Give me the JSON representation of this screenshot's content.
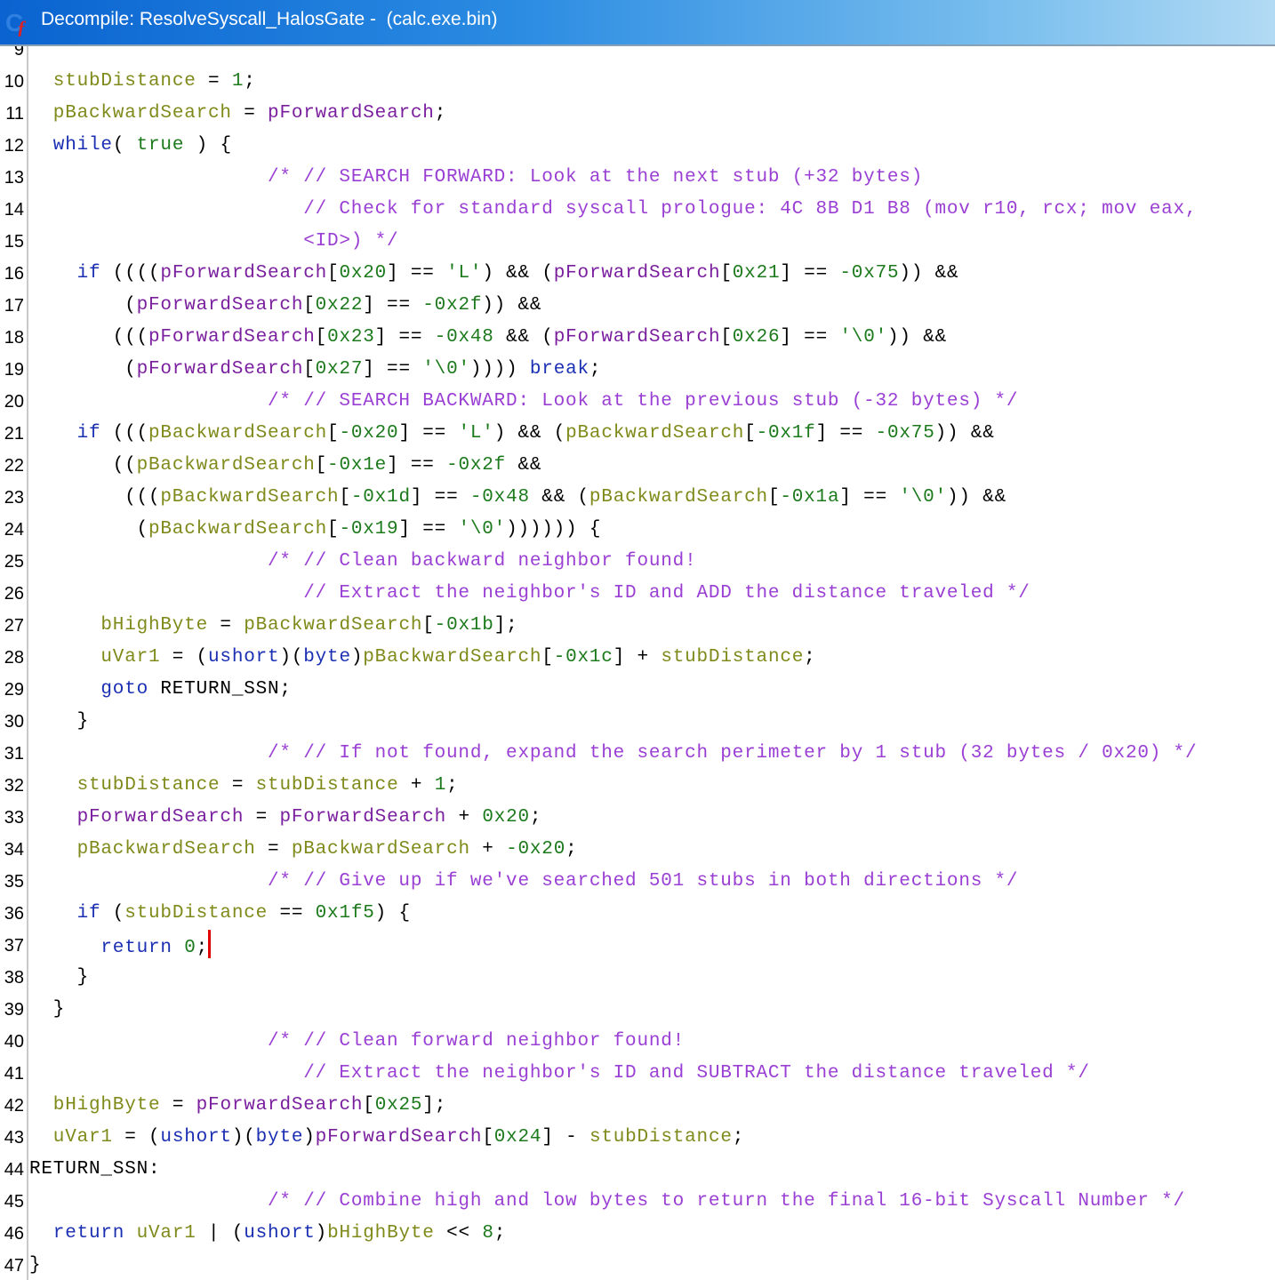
{
  "window": {
    "title": "Decompile: ResolveSyscall_HalosGate -  (calc.exe.bin)",
    "icon": "decompile-cf-icon"
  },
  "colors": {
    "keyword": "#1b2fb3",
    "variable": "#7f8a1b",
    "parameter": "#7a1f9e",
    "number": "#1c7a1c",
    "comment": "#9a3fd4",
    "cursor": "#e00000"
  },
  "code": {
    "partial_line": {
      "num": "9"
    },
    "lines": [
      {
        "num": "10",
        "indent": 2,
        "tokens": [
          {
            "t": "v",
            "s": "stubDistance"
          },
          {
            "t": "o",
            "s": " = "
          },
          {
            "t": "n",
            "s": "1"
          },
          {
            "t": "o",
            "s": ";"
          }
        ]
      },
      {
        "num": "11",
        "indent": 2,
        "tokens": [
          {
            "t": "v",
            "s": "pBackwardSearch"
          },
          {
            "t": "o",
            "s": " = "
          },
          {
            "t": "p",
            "s": "pForwardSearch"
          },
          {
            "t": "o",
            "s": ";"
          }
        ]
      },
      {
        "num": "12",
        "indent": 2,
        "tokens": [
          {
            "t": "k",
            "s": "while"
          },
          {
            "t": "o",
            "s": "( "
          },
          {
            "t": "n",
            "s": "true"
          },
          {
            "t": "o",
            "s": " ) {"
          }
        ]
      },
      {
        "num": "13",
        "indent": 20,
        "tokens": [
          {
            "t": "c",
            "s": "/* // SEARCH FORWARD: Look at the next stub (+32 bytes)"
          }
        ]
      },
      {
        "num": "14",
        "indent": 23,
        "tokens": [
          {
            "t": "c",
            "s": "// Check for standard syscall prologue: 4C 8B D1 B8 (mov r10, rcx; mov eax,"
          }
        ]
      },
      {
        "num": "15",
        "indent": 23,
        "tokens": [
          {
            "t": "c",
            "s": "<ID>) */"
          }
        ]
      },
      {
        "num": "16",
        "indent": 4,
        "tokens": [
          {
            "t": "k",
            "s": "if"
          },
          {
            "t": "o",
            "s": " (((("
          },
          {
            "t": "p",
            "s": "pForwardSearch"
          },
          {
            "t": "o",
            "s": "["
          },
          {
            "t": "n",
            "s": "0x20"
          },
          {
            "t": "o",
            "s": "] == "
          },
          {
            "t": "s",
            "s": "'L'"
          },
          {
            "t": "o",
            "s": ") && ("
          },
          {
            "t": "p",
            "s": "pForwardSearch"
          },
          {
            "t": "o",
            "s": "["
          },
          {
            "t": "n",
            "s": "0x21"
          },
          {
            "t": "o",
            "s": "] == "
          },
          {
            "t": "n",
            "s": "-0x75"
          },
          {
            "t": "o",
            "s": ")) &&"
          }
        ]
      },
      {
        "num": "17",
        "indent": 8,
        "tokens": [
          {
            "t": "o",
            "s": "("
          },
          {
            "t": "p",
            "s": "pForwardSearch"
          },
          {
            "t": "o",
            "s": "["
          },
          {
            "t": "n",
            "s": "0x22"
          },
          {
            "t": "o",
            "s": "] == "
          },
          {
            "t": "n",
            "s": "-0x2f"
          },
          {
            "t": "o",
            "s": ")) &&"
          }
        ]
      },
      {
        "num": "18",
        "indent": 7,
        "tokens": [
          {
            "t": "o",
            "s": "((("
          },
          {
            "t": "p",
            "s": "pForwardSearch"
          },
          {
            "t": "o",
            "s": "["
          },
          {
            "t": "n",
            "s": "0x23"
          },
          {
            "t": "o",
            "s": "] == "
          },
          {
            "t": "n",
            "s": "-0x48"
          },
          {
            "t": "o",
            "s": " && ("
          },
          {
            "t": "p",
            "s": "pForwardSearch"
          },
          {
            "t": "o",
            "s": "["
          },
          {
            "t": "n",
            "s": "0x26"
          },
          {
            "t": "o",
            "s": "] == "
          },
          {
            "t": "s",
            "s": "'\\0'"
          },
          {
            "t": "o",
            "s": ")) &&"
          }
        ]
      },
      {
        "num": "19",
        "indent": 8,
        "tokens": [
          {
            "t": "o",
            "s": "("
          },
          {
            "t": "p",
            "s": "pForwardSearch"
          },
          {
            "t": "o",
            "s": "["
          },
          {
            "t": "n",
            "s": "0x27"
          },
          {
            "t": "o",
            "s": "] == "
          },
          {
            "t": "s",
            "s": "'\\0'"
          },
          {
            "t": "o",
            "s": ")))) "
          },
          {
            "t": "k",
            "s": "break"
          },
          {
            "t": "o",
            "s": ";"
          }
        ]
      },
      {
        "num": "20",
        "indent": 20,
        "tokens": [
          {
            "t": "c",
            "s": "/* // SEARCH BACKWARD: Look at the previous stub (-32 bytes) */"
          }
        ]
      },
      {
        "num": "21",
        "indent": 4,
        "tokens": [
          {
            "t": "k",
            "s": "if"
          },
          {
            "t": "o",
            "s": " ((("
          },
          {
            "t": "v",
            "s": "pBackwardSearch"
          },
          {
            "t": "o",
            "s": "["
          },
          {
            "t": "n",
            "s": "-0x20"
          },
          {
            "t": "o",
            "s": "] == "
          },
          {
            "t": "s",
            "s": "'L'"
          },
          {
            "t": "o",
            "s": ") && ("
          },
          {
            "t": "v",
            "s": "pBackwardSearch"
          },
          {
            "t": "o",
            "s": "["
          },
          {
            "t": "n",
            "s": "-0x1f"
          },
          {
            "t": "o",
            "s": "] == "
          },
          {
            "t": "n",
            "s": "-0x75"
          },
          {
            "t": "o",
            "s": ")) &&"
          }
        ]
      },
      {
        "num": "22",
        "indent": 7,
        "tokens": [
          {
            "t": "o",
            "s": "(("
          },
          {
            "t": "v",
            "s": "pBackwardSearch"
          },
          {
            "t": "o",
            "s": "["
          },
          {
            "t": "n",
            "s": "-0x1e"
          },
          {
            "t": "o",
            "s": "] == "
          },
          {
            "t": "n",
            "s": "-0x2f"
          },
          {
            "t": "o",
            "s": " &&"
          }
        ]
      },
      {
        "num": "23",
        "indent": 8,
        "tokens": [
          {
            "t": "o",
            "s": "((("
          },
          {
            "t": "v",
            "s": "pBackwardSearch"
          },
          {
            "t": "o",
            "s": "["
          },
          {
            "t": "n",
            "s": "-0x1d"
          },
          {
            "t": "o",
            "s": "] == "
          },
          {
            "t": "n",
            "s": "-0x48"
          },
          {
            "t": "o",
            "s": " && ("
          },
          {
            "t": "v",
            "s": "pBackwardSearch"
          },
          {
            "t": "o",
            "s": "["
          },
          {
            "t": "n",
            "s": "-0x1a"
          },
          {
            "t": "o",
            "s": "] == "
          },
          {
            "t": "s",
            "s": "'\\0'"
          },
          {
            "t": "o",
            "s": ")) &&"
          }
        ]
      },
      {
        "num": "24",
        "indent": 9,
        "tokens": [
          {
            "t": "o",
            "s": "("
          },
          {
            "t": "v",
            "s": "pBackwardSearch"
          },
          {
            "t": "o",
            "s": "["
          },
          {
            "t": "n",
            "s": "-0x19"
          },
          {
            "t": "o",
            "s": "] == "
          },
          {
            "t": "s",
            "s": "'\\0'"
          },
          {
            "t": "o",
            "s": ")))))) {"
          }
        ]
      },
      {
        "num": "25",
        "indent": 20,
        "tokens": [
          {
            "t": "c",
            "s": "/* // Clean backward neighbor found!"
          }
        ]
      },
      {
        "num": "26",
        "indent": 23,
        "tokens": [
          {
            "t": "c",
            "s": "// Extract the neighbor's ID and ADD the distance traveled */"
          }
        ]
      },
      {
        "num": "27",
        "indent": 6,
        "tokens": [
          {
            "t": "v",
            "s": "bHighByte"
          },
          {
            "t": "o",
            "s": " = "
          },
          {
            "t": "v",
            "s": "pBackwardSearch"
          },
          {
            "t": "o",
            "s": "["
          },
          {
            "t": "n",
            "s": "-0x1b"
          },
          {
            "t": "o",
            "s": "];"
          }
        ]
      },
      {
        "num": "28",
        "indent": 6,
        "tokens": [
          {
            "t": "v",
            "s": "uVar1"
          },
          {
            "t": "o",
            "s": " = ("
          },
          {
            "t": "t",
            "s": "ushort"
          },
          {
            "t": "o",
            "s": ")("
          },
          {
            "t": "t",
            "s": "byte"
          },
          {
            "t": "o",
            "s": ")"
          },
          {
            "t": "v",
            "s": "pBackwardSearch"
          },
          {
            "t": "o",
            "s": "["
          },
          {
            "t": "n",
            "s": "-0x1c"
          },
          {
            "t": "o",
            "s": "] + "
          },
          {
            "t": "v",
            "s": "stubDistance"
          },
          {
            "t": "o",
            "s": ";"
          }
        ]
      },
      {
        "num": "29",
        "indent": 6,
        "tokens": [
          {
            "t": "k",
            "s": "goto"
          },
          {
            "t": "o",
            "s": " RETURN_SSN;"
          }
        ]
      },
      {
        "num": "30",
        "indent": 4,
        "tokens": [
          {
            "t": "o",
            "s": "}"
          }
        ]
      },
      {
        "num": "31",
        "indent": 20,
        "tokens": [
          {
            "t": "c",
            "s": "/* // If not found, expand the search perimeter by 1 stub (32 bytes / 0x20) */"
          }
        ]
      },
      {
        "num": "32",
        "indent": 4,
        "tokens": [
          {
            "t": "v",
            "s": "stubDistance"
          },
          {
            "t": "o",
            "s": " = "
          },
          {
            "t": "v",
            "s": "stubDistance"
          },
          {
            "t": "o",
            "s": " + "
          },
          {
            "t": "n",
            "s": "1"
          },
          {
            "t": "o",
            "s": ";"
          }
        ]
      },
      {
        "num": "33",
        "indent": 4,
        "tokens": [
          {
            "t": "p",
            "s": "pForwardSearch"
          },
          {
            "t": "o",
            "s": " = "
          },
          {
            "t": "p",
            "s": "pForwardSearch"
          },
          {
            "t": "o",
            "s": " + "
          },
          {
            "t": "n",
            "s": "0x20"
          },
          {
            "t": "o",
            "s": ";"
          }
        ]
      },
      {
        "num": "34",
        "indent": 4,
        "tokens": [
          {
            "t": "v",
            "s": "pBackwardSearch"
          },
          {
            "t": "o",
            "s": " = "
          },
          {
            "t": "v",
            "s": "pBackwardSearch"
          },
          {
            "t": "o",
            "s": " + "
          },
          {
            "t": "n",
            "s": "-0x20"
          },
          {
            "t": "o",
            "s": ";"
          }
        ]
      },
      {
        "num": "35",
        "indent": 20,
        "tokens": [
          {
            "t": "c",
            "s": "/* // Give up if we've searched 501 stubs in both directions */"
          }
        ]
      },
      {
        "num": "36",
        "indent": 4,
        "tokens": [
          {
            "t": "k",
            "s": "if"
          },
          {
            "t": "o",
            "s": " ("
          },
          {
            "t": "v",
            "s": "stubDistance"
          },
          {
            "t": "o",
            "s": " == "
          },
          {
            "t": "n",
            "s": "0x1f5"
          },
          {
            "t": "o",
            "s": ") {"
          }
        ]
      },
      {
        "num": "37",
        "indent": 6,
        "tokens": [
          {
            "t": "k",
            "s": "return"
          },
          {
            "t": "o",
            "s": " "
          },
          {
            "t": "n",
            "s": "0"
          },
          {
            "t": "o",
            "s": ";"
          }
        ],
        "cursor": true
      },
      {
        "num": "38",
        "indent": 4,
        "tokens": [
          {
            "t": "o",
            "s": "}"
          }
        ]
      },
      {
        "num": "39",
        "indent": 2,
        "tokens": [
          {
            "t": "o",
            "s": "}"
          }
        ]
      },
      {
        "num": "40",
        "indent": 20,
        "tokens": [
          {
            "t": "c",
            "s": "/* // Clean forward neighbor found!"
          }
        ]
      },
      {
        "num": "41",
        "indent": 23,
        "tokens": [
          {
            "t": "c",
            "s": "// Extract the neighbor's ID and SUBTRACT the distance traveled */"
          }
        ]
      },
      {
        "num": "42",
        "indent": 2,
        "tokens": [
          {
            "t": "v",
            "s": "bHighByte"
          },
          {
            "t": "o",
            "s": " = "
          },
          {
            "t": "p",
            "s": "pForwardSearch"
          },
          {
            "t": "o",
            "s": "["
          },
          {
            "t": "n",
            "s": "0x25"
          },
          {
            "t": "o",
            "s": "];"
          }
        ]
      },
      {
        "num": "43",
        "indent": 2,
        "tokens": [
          {
            "t": "v",
            "s": "uVar1"
          },
          {
            "t": "o",
            "s": " = ("
          },
          {
            "t": "t",
            "s": "ushort"
          },
          {
            "t": "o",
            "s": ")("
          },
          {
            "t": "t",
            "s": "byte"
          },
          {
            "t": "o",
            "s": ")"
          },
          {
            "t": "p",
            "s": "pForwardSearch"
          },
          {
            "t": "o",
            "s": "["
          },
          {
            "t": "n",
            "s": "0x24"
          },
          {
            "t": "o",
            "s": "] - "
          },
          {
            "t": "v",
            "s": "stubDistance"
          },
          {
            "t": "o",
            "s": ";"
          }
        ]
      },
      {
        "num": "44",
        "indent": 0,
        "tokens": [
          {
            "t": "l",
            "s": "RETURN_SSN:"
          }
        ]
      },
      {
        "num": "45",
        "indent": 20,
        "tokens": [
          {
            "t": "c",
            "s": "/* // Combine high and low bytes to return the final 16-bit Syscall Number */"
          }
        ]
      },
      {
        "num": "46",
        "indent": 2,
        "tokens": [
          {
            "t": "k",
            "s": "return"
          },
          {
            "t": "o",
            "s": " "
          },
          {
            "t": "v",
            "s": "uVar1"
          },
          {
            "t": "o",
            "s": " | ("
          },
          {
            "t": "t",
            "s": "ushort"
          },
          {
            "t": "o",
            "s": ")"
          },
          {
            "t": "v",
            "s": "bHighByte"
          },
          {
            "t": "o",
            "s": " << "
          },
          {
            "t": "n",
            "s": "8"
          },
          {
            "t": "o",
            "s": ";"
          }
        ]
      },
      {
        "num": "47",
        "indent": 0,
        "tokens": [
          {
            "t": "o",
            "s": "}"
          }
        ]
      }
    ]
  }
}
